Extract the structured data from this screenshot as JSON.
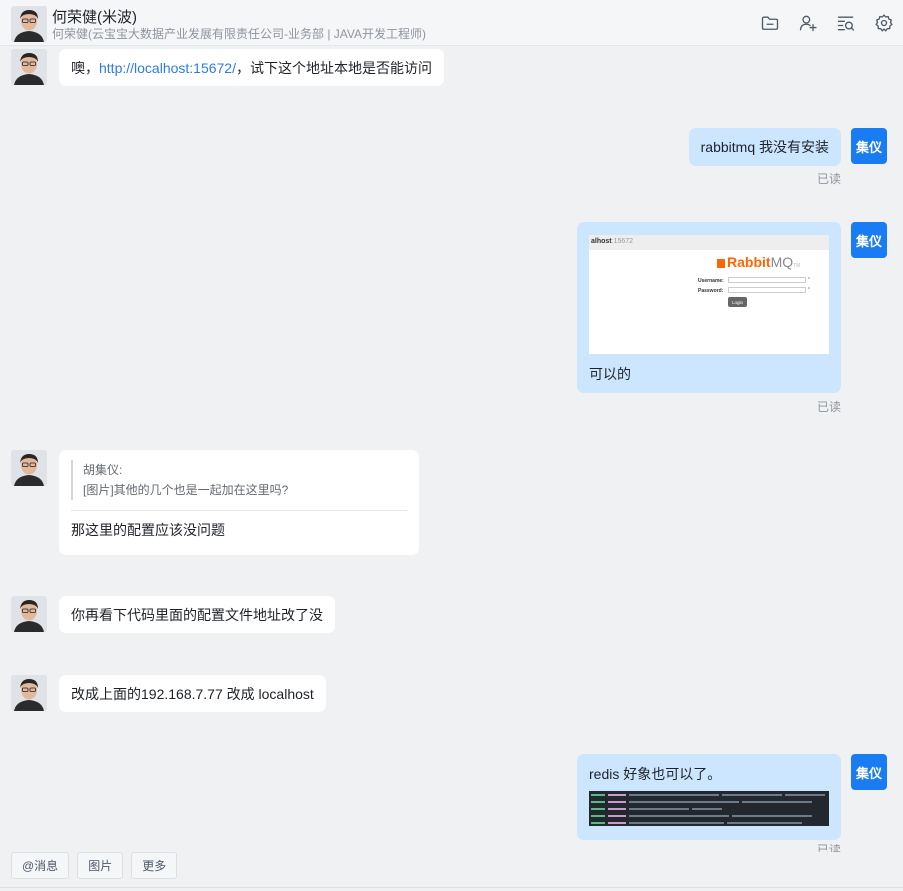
{
  "header": {
    "name": "何荣健(米波)",
    "subtitle": "何荣健(云宝宝大数据产业发展有限责任公司-业务部 | JAVA开发工程师)"
  },
  "self": {
    "avatar_text": "集仪"
  },
  "messages": [
    {
      "side": "left",
      "prefix": "噢，",
      "link": "http://localhost:15672/",
      "suffix": "，试下这个地址本地是否能访问"
    },
    {
      "side": "right",
      "text": "rabbitmq  我没有安装",
      "status": "已读"
    },
    {
      "side": "right",
      "screenshot": {
        "url_host": "alhost",
        "url_port": ":15672",
        "logo_main": "Rabbit",
        "logo_mq": "MQ",
        "logo_tm": "TM",
        "username_label": "Username:",
        "password_label": "Password:",
        "login_button": "Login",
        "asterisk": "*"
      },
      "text": "可以的",
      "status": "已读"
    },
    {
      "side": "left",
      "quote_author": "胡集仪:",
      "quote_text": "[图片]其他的几个也是一起加在这里吗?",
      "text": "那这里的配置应该没问题"
    },
    {
      "side": "left",
      "text": "你再看下代码里面的配置文件地址改了没"
    },
    {
      "side": "left",
      "text": "改成上面的192.168.7.77 改成 localhost"
    },
    {
      "side": "right",
      "text": "redis 好象也可以了。",
      "status": "已读"
    }
  ],
  "toolbar": {
    "mention": "@消息",
    "image": "图片",
    "more": "更多"
  },
  "icons": [
    "folder-icon",
    "add-user-icon",
    "search-history-icon",
    "settings-icon"
  ]
}
